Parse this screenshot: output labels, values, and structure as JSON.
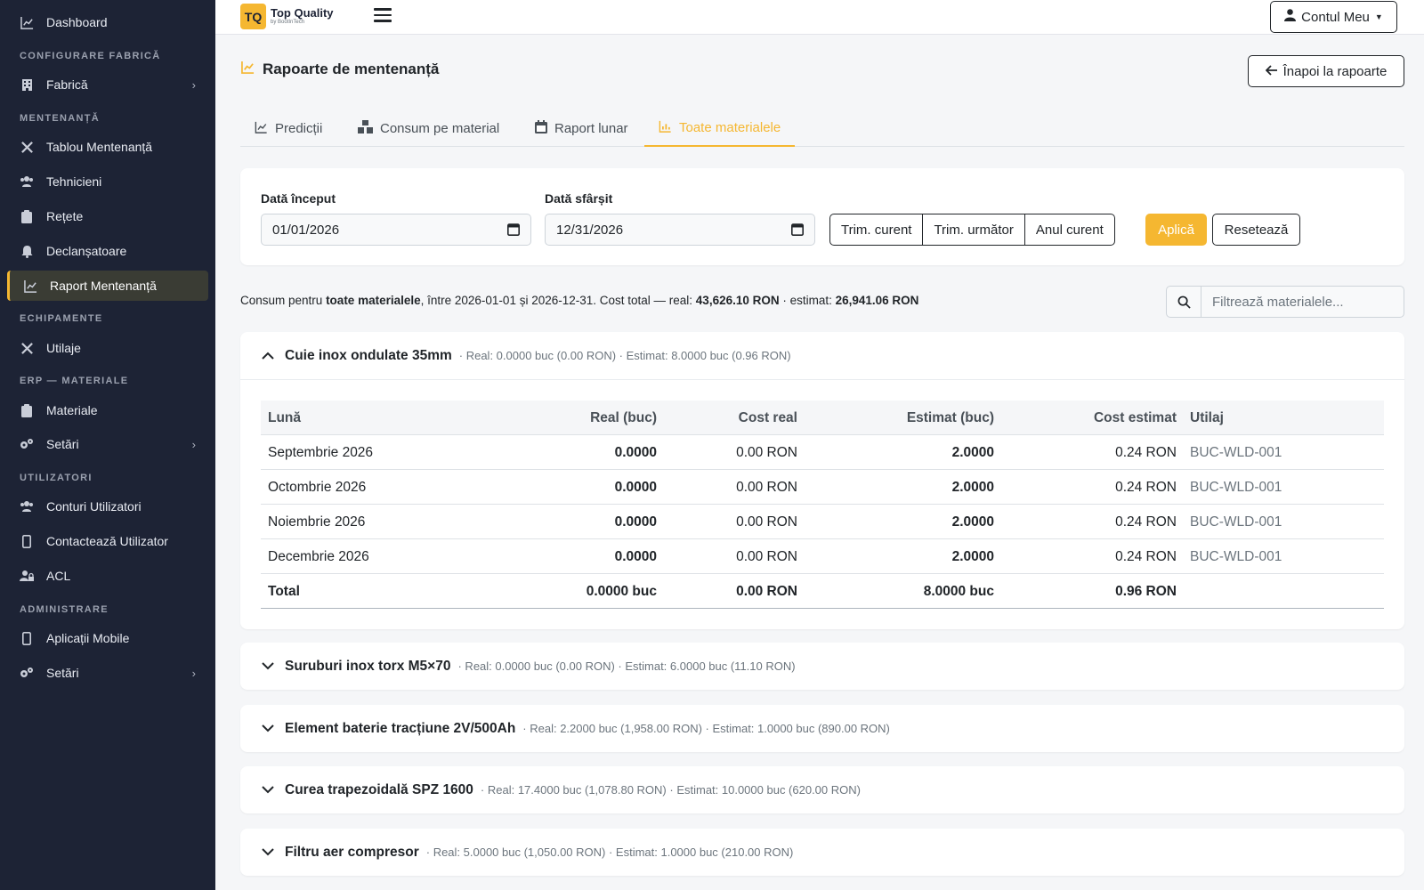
{
  "sidebar": {
    "dashboard": "Dashboard",
    "sec_config": "CONFIGURARE FABRICĂ",
    "fabrica": "Fabrică",
    "sec_mentenanta": "MENTENANȚĂ",
    "tablou": "Tablou Mentenanță",
    "tehnicieni": "Tehnicieni",
    "retete": "Rețete",
    "declansatoare": "Declanșatoare",
    "raport": "Raport Mentenanță",
    "sec_echipamente": "ECHIPAMENTE",
    "utilaje": "Utilaje",
    "sec_erp": "ERP — MATERIALE",
    "materiale": "Materiale",
    "setari1": "Setări",
    "sec_utilizatori": "UTILIZATORI",
    "conturi": "Conturi Utilizatori",
    "contacteaza": "Contactează Utilizator",
    "acl": "ACL",
    "sec_admin": "ADMINISTRARE",
    "aplicatii": "Aplicații Mobile",
    "setari2": "Setări"
  },
  "topbar": {
    "logo_mark": "TQ",
    "logo_name": "Top Quality",
    "logo_sub": "by BootInTech",
    "account": "Contul Meu"
  },
  "page": {
    "title": "Rapoarte de mentenanță",
    "back": "Înapoi la rapoarte"
  },
  "tabs": [
    "Predicții",
    "Consum pe material",
    "Raport lunar",
    "Toate materialele"
  ],
  "filters": {
    "start_label": "Dată început",
    "start_value": "01/01/2026",
    "end_label": "Dată sfârșit",
    "end_value": "12/31/2026",
    "presets": [
      "Trim. curent",
      "Trim. următor",
      "Anul curent"
    ],
    "apply": "Aplică",
    "reset": "Resetează"
  },
  "summary": {
    "p1": "Consum pentru ",
    "b1": "toate materialele",
    "p2": ", între 2026-01-01 și 2026-12-31. Cost total — real: ",
    "b2": "43,626.10 RON",
    "p3": " · estimat: ",
    "b3": "26,941.06 RON"
  },
  "search": {
    "placeholder": "Filtrează materialele..."
  },
  "table": {
    "headers": [
      "Lună",
      "Real (buc)",
      "Cost real",
      "Estimat (buc)",
      "Cost estimat",
      "Utilaj"
    ],
    "rows": [
      [
        "Septembrie 2026",
        "0.0000",
        "0.00 RON",
        "2.0000",
        "0.24 RON",
        "BUC-WLD-001"
      ],
      [
        "Octombrie 2026",
        "0.0000",
        "0.00 RON",
        "2.0000",
        "0.24 RON",
        "BUC-WLD-001"
      ],
      [
        "Noiembrie 2026",
        "0.0000",
        "0.00 RON",
        "2.0000",
        "0.24 RON",
        "BUC-WLD-001"
      ],
      [
        "Decembrie 2026",
        "0.0000",
        "0.00 RON",
        "2.0000",
        "0.24 RON",
        "BUC-WLD-001"
      ]
    ],
    "total": [
      "Total",
      "0.0000 buc",
      "0.00 RON",
      "8.0000 buc",
      "0.96 RON",
      ""
    ]
  },
  "materials": [
    {
      "name": "Cuie inox ondulate 35mm",
      "meta": "· Real: 0.0000 buc (0.00 RON) · Estimat: 8.0000 buc (0.96 RON)"
    },
    {
      "name": "Suruburi inox torx M5×70",
      "meta": "· Real: 0.0000 buc (0.00 RON) · Estimat: 6.0000 buc (11.10 RON)"
    },
    {
      "name": "Element baterie tracțiune 2V/500Ah",
      "meta": "· Real: 2.2000 buc (1,958.00 RON) · Estimat: 1.0000 buc (890.00 RON)"
    },
    {
      "name": "Curea trapezoidală SPZ 1600",
      "meta": "· Real: 17.4000 buc (1,078.80 RON) · Estimat: 10.0000 buc (620.00 RON)"
    },
    {
      "name": "Filtru aer compresor",
      "meta": "· Real: 5.0000 buc (1,050.00 RON) · Estimat: 1.0000 buc (210.00 RON)"
    }
  ]
}
